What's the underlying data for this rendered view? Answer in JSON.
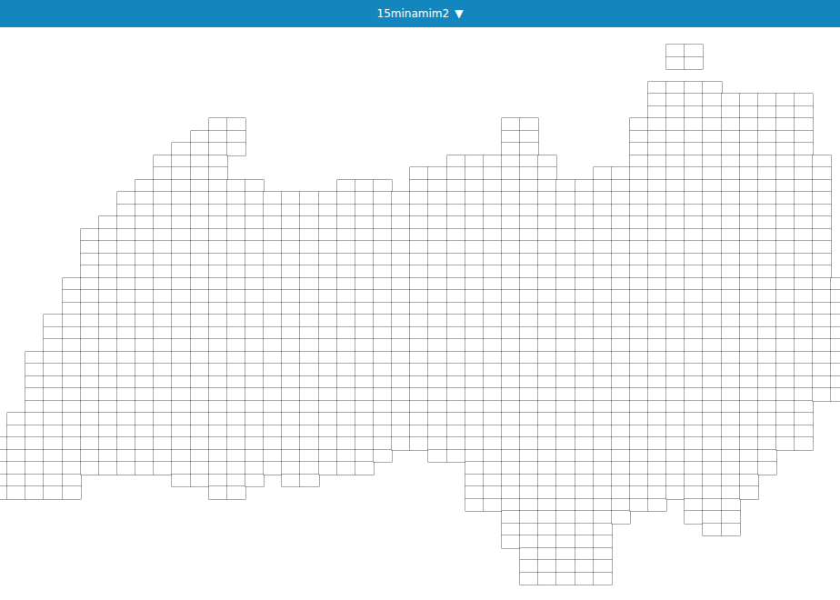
{
  "header": {
    "title": "15minamim2",
    "dropdown_icon": "▼"
  }
}
